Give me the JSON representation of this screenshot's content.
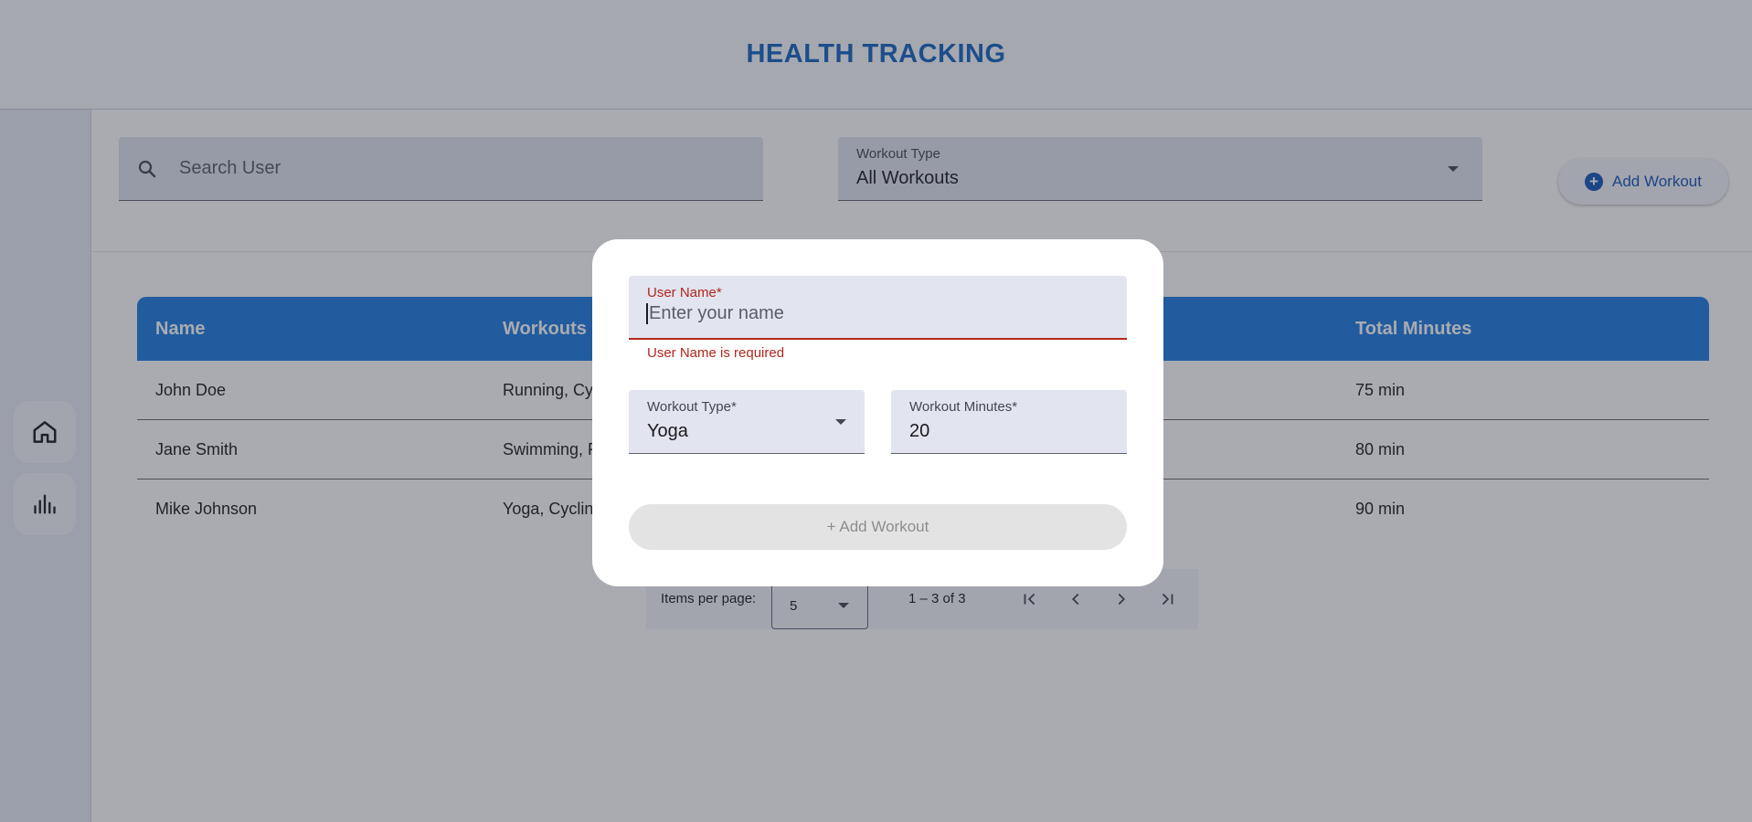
{
  "header": {
    "title": "HEALTH TRACKING"
  },
  "sidenav": {
    "items": [
      {
        "icon": "home-icon"
      },
      {
        "icon": "bar-chart-icon"
      }
    ]
  },
  "toolbar": {
    "search": {
      "placeholder": "Search User",
      "icon": "search-icon"
    },
    "workout_type": {
      "label": "Workout Type",
      "value": "All Workouts"
    },
    "add_button": {
      "label": "Add Workout",
      "icon": "add-circle-icon"
    }
  },
  "table": {
    "columns": [
      "Name",
      "Workouts",
      "Total Minutes"
    ],
    "rows": [
      {
        "name": "John Doe",
        "workouts": "Running, Cyc",
        "total": "75 min"
      },
      {
        "name": "Jane Smith",
        "workouts": "Swimming, F",
        "total": "80 min"
      },
      {
        "name": "Mike Johnson",
        "workouts": "Yoga, Cyclin",
        "total": "90 min"
      }
    ]
  },
  "paginator": {
    "items_per_page_label": "Items per page:",
    "items_per_page": "5",
    "range": "1 – 3 of 3"
  },
  "dialog": {
    "user_name": {
      "label": "User Name*",
      "placeholder": "Enter your name",
      "value": "",
      "error": "User Name is required"
    },
    "workout_type": {
      "label": "Workout Type*",
      "value": "Yoga"
    },
    "workout_minutes": {
      "label": "Workout Minutes*",
      "value": "20"
    },
    "submit_label": "+ Add Workout"
  },
  "colors": {
    "brand": "#1565c0",
    "table_header": "#1e7be0",
    "error": "#b3261e",
    "field_bg": "#e2e4ef"
  }
}
